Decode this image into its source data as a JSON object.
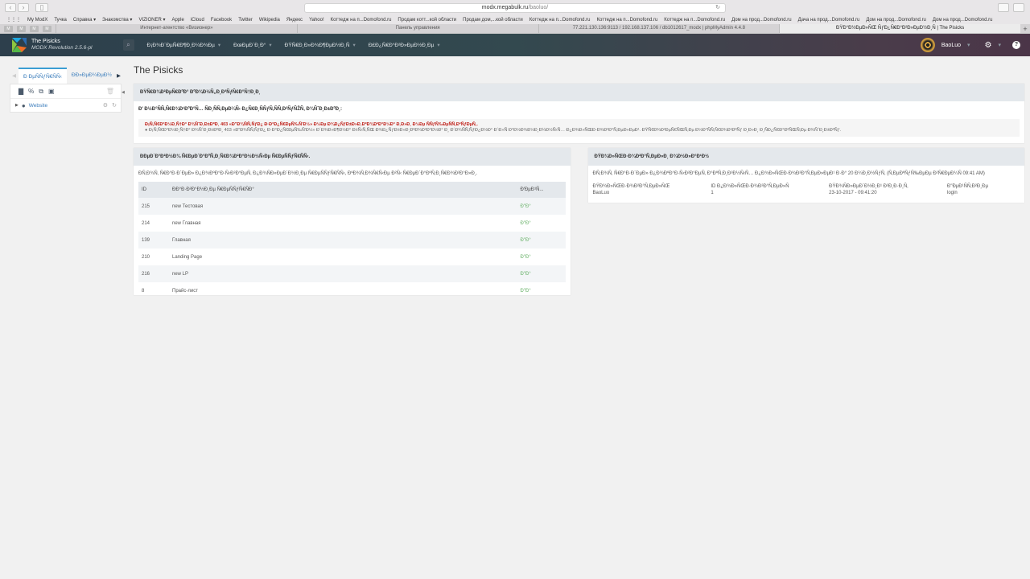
{
  "browser": {
    "url_host": "modx.megabulk.ru",
    "url_path": "/baoluo/",
    "bookmarks": [
      "My ModX",
      "Тучка",
      "Справка ▾",
      "Знакомства ▾",
      "VIZIONER ▾",
      "Apple",
      "iCloud",
      "Facebook",
      "Twitter",
      "Wikipedia",
      "Яндекс",
      "Yahoo!",
      "Коттедж на п...Domofond.ru",
      "Продам котт...кой области",
      "Продам дом,...кой области",
      "Коттедж на п...Domofond.ru",
      "Коттедж на п...Domofond.ru",
      "Коттедж на п...Domofond.ru",
      "Дом на прод...Domofond.ru",
      "Дача на прод...Domofond.ru",
      "Дом на прод...Domofond.ru",
      "Дом на прод...Domofond.ru"
    ],
    "pinned": [
      "M",
      "M",
      "M",
      "M"
    ],
    "tabs": [
      "Интернет-агентство «Визионер»",
      "Панель управления",
      "77.221.130.136:9113 / 192.168.137.106 / db1012617_modx | phpMyAdmin 4.4.8",
      "ÐŸÐ°Ð½ÐµÐ»ÑŒ ÑƒÐ¿Ñ€Ð°Ð²Ð»ÐµÐ½Ð¸Ñ | The Pisicks"
    ]
  },
  "manager": {
    "site_name": "The Pisicks",
    "version": "MODX Revolution 2.5.6-pl",
    "menu": [
      "Ð¡Ð¾Ð´ÐµÑ€Ð¶Ð¸Ð¼Ð¾Ðµ",
      "ÐœÐµÐ´Ð¸Ð°",
      "ÐŸÑ€Ð¸Ð»Ð¾Ð¶ÐµÐ½Ð¸Ñ",
      "Ð£Ð¿Ñ€Ð°Ð²Ð»ÐµÐ½Ð¸Ðµ"
    ],
    "user": "BaoLuo"
  },
  "left": {
    "tabs": [
      "Ð ÐµÑÑƒÑ€ÑÑ‹",
      "Ð­Ð»ÐµÐ¼ÐµÐ½"
    ],
    "tree_root": "Website"
  },
  "page_title": "The Pisicks",
  "security": {
    "title": "ÐŸÑ€Ð¾Ð²ÐµÑ€ÐºÐ° ÐºÐ¾Ð½Ñ„Ð¸Ð³ÑƒÑ€Ð°Ñ†Ð¸Ð¸",
    "text": "Ð' Ð½Ð°ÑÑ‚Ñ€Ð¾Ð¹ÐºÐ°Ñ… ÑÐ¸ÑÑ‚ÐµÐ¼Ñ‹ Ð¿Ñ€Ð¸ÑÑƒÑ‚ÑÑ‚Ð²ÑƒÑŽÑ‚ Ð¾ÑˆÐ¸Ð±ÐºÐ¸:",
    "warn_title": "Ð¡Ñ‚Ñ€Ð°Ð½Ð¸Ñ†Ð° Ð¾ÑˆÐ¸Ð±ÐºÐ¸ 403 «Ð\"Ð¾ÑÑ‚ÑƒÐ¿ Ð·Ð°Ð¿Ñ€ÐµÑ‰Ñ'Ð½» Ð½Ðµ Ð¾Ð¿ÑƒÐ±Ð»Ð¸ÐºÐ¾Ð²Ð°Ð½Ð° Ð¸Ð»Ð¸ Ð½Ðµ ÑÑƒÑ‰ÐµÑÑ‚Ð²ÑƒÐµÑ‚.",
    "warn_text": "Ð¡Ñ‚Ñ€Ð°Ð½Ð¸Ñ†Ð° Ð¾ÑˆÐ¸Ð±ÐºÐ¸ 403 «Ð\"Ð¾ÑÑ‚ÑƒÐ¿ Ð·Ð°Ð¿Ñ€ÐµÑ‰Ñ'Ð½» Ð´Ð¾Ð»Ð¶Ð½Ð° Ð±Ñ‹Ñ‚ÑŒ Ð¾Ð¿ÑƒÐ±Ð»Ð¸ÐºÐ¾Ð²Ð°Ð½Ð° Ð¸ Ð´Ð¾ÑÑ‚ÑƒÐ¿Ð½Ð° Ð´Ð»Ñ Ð°Ð½Ð¾Ð½Ð¸Ð¼Ð½Ñ‹Ñ… Ð¿Ð¾Ð»ÑŒÐ·Ð¾Ð²Ð°Ñ‚ÐµÐ»ÐµÐ¹. ÐŸÑ€Ð¾Ð²ÐµÑ€ÑŒÑ‚Ðµ Ð½Ð°ÑÑ‚Ñ€Ð¾Ð¹ÐºÑƒ Ð¸Ð»Ð¸ Ð¸ÑÐ¿Ñ€Ð°Ð²ÑŒÑ‚Ðµ Ð¾ÑˆÐ¸Ð±ÐºÑƒ."
  },
  "recent": {
    "title": "ÐÐµÐ´Ð°Ð²Ð½Ð¾ Ñ€ÐµÐ´Ð°ÐºÑ‚Ð¸Ñ€Ð¾Ð²Ð°Ð½Ð½Ñ‹Ðµ Ñ€ÐµÑÑƒÑ€ÑÑ‹.",
    "text": "Ð­Ñ‚Ð¾Ñ‚ Ñ€Ð°Ð·Ð´ÐµÐ» Ð¿Ð¾ÐºÐ°Ð·Ñ‹Ð²Ð°ÐµÑ‚ Ð¿Ð¾ÑÐ»ÐµÐ´Ð½Ð¸Ðµ Ñ€ÐµÑÑƒÑ€ÑÑ‹, ÐºÐ¾Ñ‚Ð¾Ñ€Ñ‹Ðµ Ð²Ñ‹ Ñ€ÐµÐ´Ð°ÐºÑ‚Ð¸Ñ€Ð¾Ð²Ð°Ð»Ð¸.",
    "columns": [
      "ID",
      "ÐÐ°Ð·Ð²Ð°Ð½Ð¸Ðµ Ñ€ÐµÑÑƒÑ€ÑÐ°",
      "Ð'ÐµÐ¹Ñ..."
    ],
    "rows": [
      [
        "215",
        "new Тестовая",
        "Ð\"Ð°"
      ],
      [
        "214",
        "new Главная",
        "Ð\"Ð°"
      ],
      [
        "139",
        "Главная",
        "Ð\"Ð°"
      ],
      [
        "210",
        "Landing Page",
        "Ð\"Ð°"
      ],
      [
        "216",
        "new LP",
        "Ð\"Ð°"
      ],
      [
        "8",
        "Прайс-лист",
        "Ð\"Ð°"
      ]
    ]
  },
  "online": {
    "title": "ÐŸÐ¾Ð»ÑŒÐ·Ð¾Ð²Ð°Ñ‚ÐµÐ»Ð¸ Ð¾Ð½Ð»Ð°Ð¹Ð½",
    "text": "Ð­Ñ‚Ð¾Ñ‚ Ñ€Ð°Ð·Ð´ÐµÐ» Ð¿Ð¾ÐºÐ°Ð·Ñ‹Ð²Ð°ÐµÑ‚ Ð°ÐºÑ‚Ð¸Ð²Ð½Ñ‹Ñ… Ð¿Ð¾Ð»ÑŒÐ·Ð¾Ð²Ð°Ñ‚ÐµÐ»ÐµÐ¹ Ð·Ð° 20 Ð¼Ð¸Ð½ÑƒÑ‚ (Ñ‚ÐµÐºÑƒÑ‰ÐµÐµ Ð²Ñ€ÐµÐ¼Ñ 09:41 AM)",
    "columns": [
      "ÐŸÐ¾Ð»ÑŒÐ·Ð¾Ð²Ð°Ñ‚ÐµÐ»ÑŒ",
      "ID Ð¿Ð¾Ð»ÑŒÐ·Ð¾Ð²Ð°Ñ‚ÐµÐ»Ñ",
      "ÐŸÐ¾ÑÐ»ÐµÐ´Ð½Ð¸Ð¹ Ð²Ð¸Ð·Ð¸Ñ‚",
      "Ð\"ÐµÐ¹ÑÑ‚Ð²Ð¸Ðµ"
    ],
    "row": [
      "BaoLuo",
      "1",
      "23-10-2017 - 09:41:20",
      "login"
    ]
  }
}
